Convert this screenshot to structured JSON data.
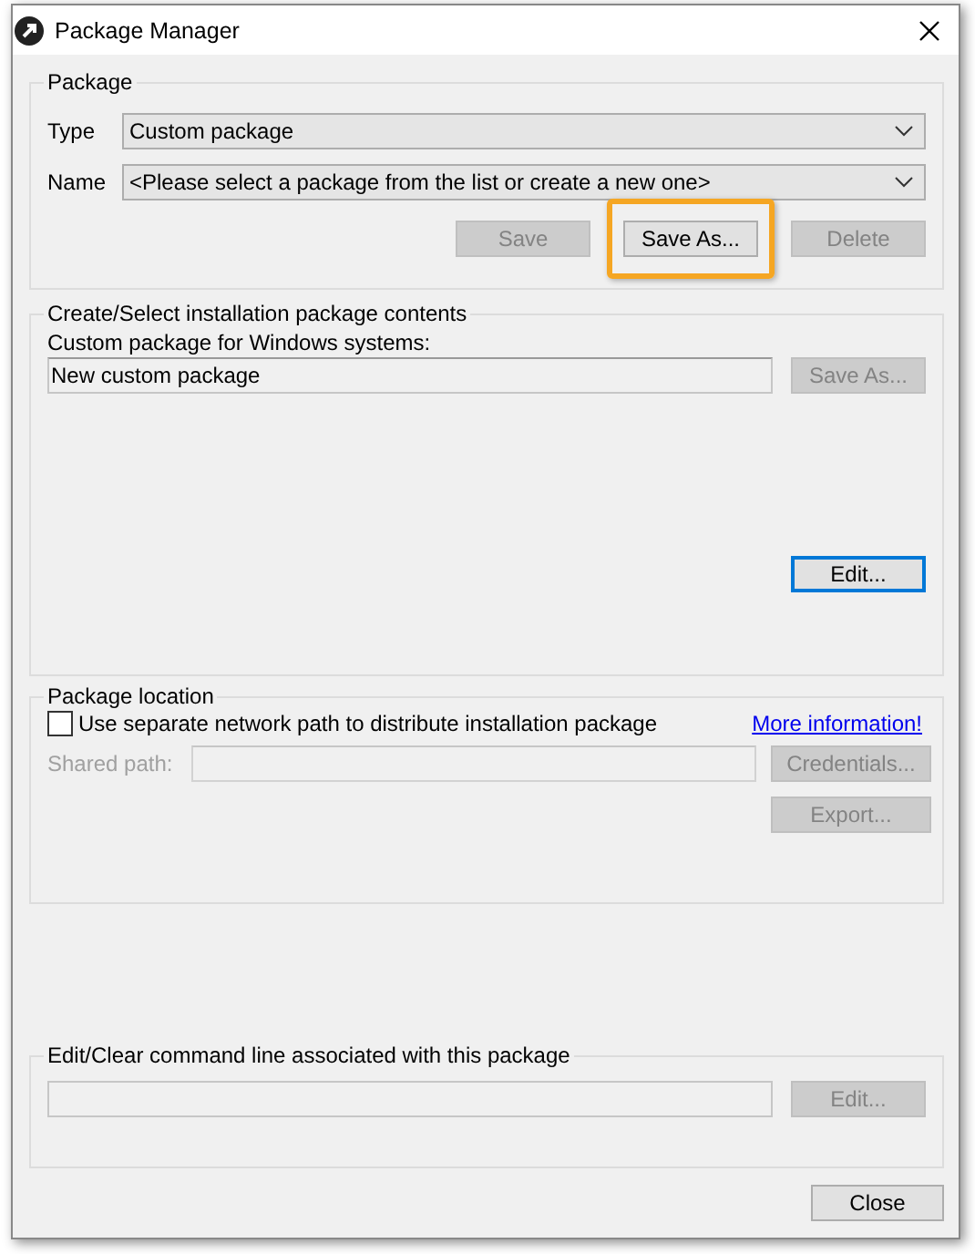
{
  "window": {
    "title": "Package Manager"
  },
  "package": {
    "legend": "Package",
    "type": {
      "label": "Type",
      "value": "Custom package"
    },
    "name": {
      "label": "Name",
      "value": "<Please select a package from the list or create a new one>"
    },
    "buttons": [
      {
        "label": "Save",
        "disabled": true,
        "highlighted": false
      },
      {
        "label": "Save As...",
        "disabled": false,
        "highlighted": true
      },
      {
        "label": "Delete",
        "disabled": true,
        "highlighted": false
      }
    ]
  },
  "contents": {
    "legend": "Create/Select installation package contents",
    "label": "Custom package for Windows systems:",
    "value": "New custom package",
    "save_as": {
      "label": "Save As...",
      "disabled": true,
      "focused": false
    },
    "edit": {
      "label": "Edit...",
      "disabled": false,
      "focused": true
    }
  },
  "location": {
    "legend": "Package location",
    "checkbox": {
      "label": "Use separate network path to distribute installation package",
      "checked": false
    },
    "link": "More information!",
    "shared_path": {
      "label": "Shared path:",
      "disabled": true
    },
    "buttons": [
      {
        "label": "Credentials...",
        "disabled": true
      },
      {
        "label": "Export...",
        "disabled": true
      }
    ]
  },
  "command": {
    "legend": "Edit/Clear command line associated with this package",
    "edit": {
      "label": "Edit...",
      "disabled": true
    }
  },
  "close": {
    "label": "Close",
    "disabled": false
  }
}
